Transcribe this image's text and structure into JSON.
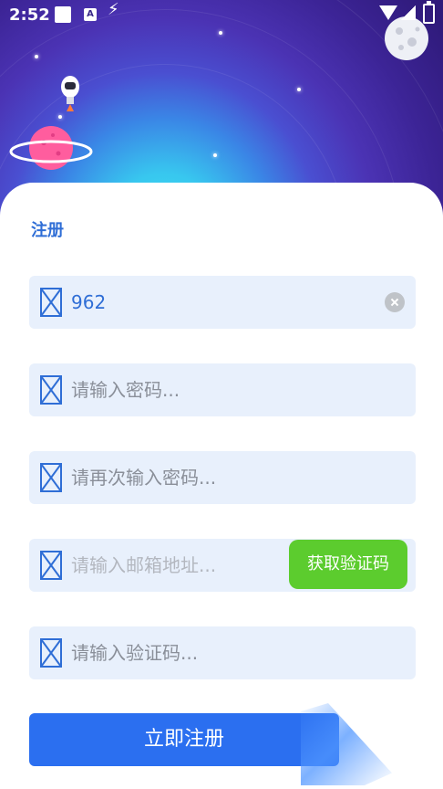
{
  "status_bar": {
    "time": "2:52",
    "notif_letter": "A"
  },
  "form": {
    "title": "注册",
    "username_value": "962",
    "password_placeholder": "请输入密码...",
    "confirm_placeholder": "请再次输入密码...",
    "email_placeholder": "请输入邮箱地址...",
    "get_code_label": "获取验证码",
    "code_placeholder": "请输入验证码...",
    "submit_label": "立即注册"
  },
  "colors": {
    "accent": "#2f6ed6",
    "primary_button": "#2b6ff0",
    "code_button": "#5ccc2e",
    "field_bg": "#e8f0fc"
  },
  "icons": {
    "field_icon": "broken-image-icon",
    "clear_icon": "clear-icon",
    "planet": "ringed-planet-icon",
    "rocket": "astronaut-rocket-icon",
    "moon": "moon-icon"
  }
}
